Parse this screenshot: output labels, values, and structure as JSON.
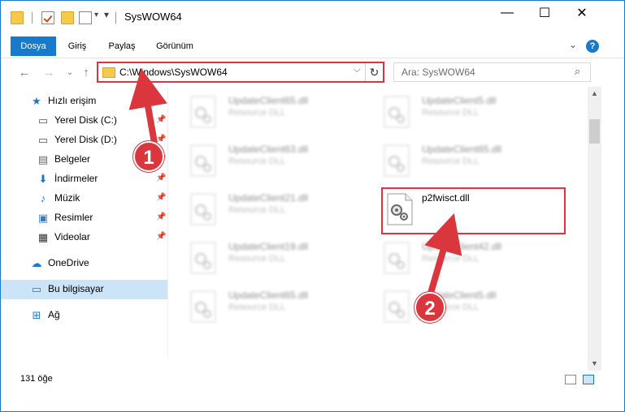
{
  "window": {
    "title": "SysWOW64",
    "minimize": "—",
    "maximize": "☐",
    "close": "✕"
  },
  "ribbon": {
    "tabs": [
      {
        "label": "Dosya",
        "active": true
      },
      {
        "label": "Giriş",
        "active": false
      },
      {
        "label": "Paylaş",
        "active": false
      },
      {
        "label": "Görünüm",
        "active": false
      }
    ],
    "help": "?"
  },
  "address": {
    "path": "C:\\Windows\\SysWOW64",
    "search_placeholder": "Ara: SysWOW64"
  },
  "sidebar": {
    "items": [
      {
        "label": "Hızlı erişim",
        "icon": "star-icon",
        "pinned": false
      },
      {
        "label": "Yerel Disk (C:)",
        "icon": "drive-icon",
        "pinned": true
      },
      {
        "label": "Yerel Disk (D:)",
        "icon": "drive-icon",
        "pinned": true
      },
      {
        "label": "Belgeler",
        "icon": "document-icon",
        "pinned": true
      },
      {
        "label": "İndirmeler",
        "icon": "download-icon",
        "pinned": true
      },
      {
        "label": "Müzik",
        "icon": "music-icon",
        "pinned": true
      },
      {
        "label": "Resimler",
        "icon": "picture-icon",
        "pinned": true
      },
      {
        "label": "Videolar",
        "icon": "video-icon",
        "pinned": true
      },
      {
        "label": "OneDrive",
        "icon": "cloud-icon",
        "pinned": false
      },
      {
        "label": "Bu bilgisayar",
        "icon": "computer-icon",
        "pinned": false,
        "selected": true
      },
      {
        "label": "Ağ",
        "icon": "network-icon",
        "pinned": false
      }
    ]
  },
  "files": [
    {
      "name": "UpdateClient65.dll",
      "type": "Resource DLL"
    },
    {
      "name": "UpdateClient5.dll",
      "type": "Resource DLL"
    },
    {
      "name": "UpdateClient63.dll",
      "type": "Resource DLL"
    },
    {
      "name": "UpdateClient65.dll",
      "type": "Resource DLL"
    },
    {
      "name": "UpdateClient21.dll",
      "type": "Resource DLL"
    },
    {
      "name": "p2fwisct.dll",
      "type": ""
    },
    {
      "name": "UpdateClient19.dll",
      "type": "Resource DLL"
    },
    {
      "name": "UpdateClient42.dll",
      "type": "Resource DLL"
    },
    {
      "name": "UpdateClient65.dll",
      "type": "Resource DLL"
    },
    {
      "name": "UpdateClient5.dll",
      "type": "Resource DLL"
    }
  ],
  "status": {
    "item_count": "131 öğe"
  },
  "callouts": {
    "step1": "1",
    "step2": "2"
  },
  "colors": {
    "accent": "#1979ca",
    "highlight": "#d9363e",
    "selected_nav": "#cce4f7"
  }
}
